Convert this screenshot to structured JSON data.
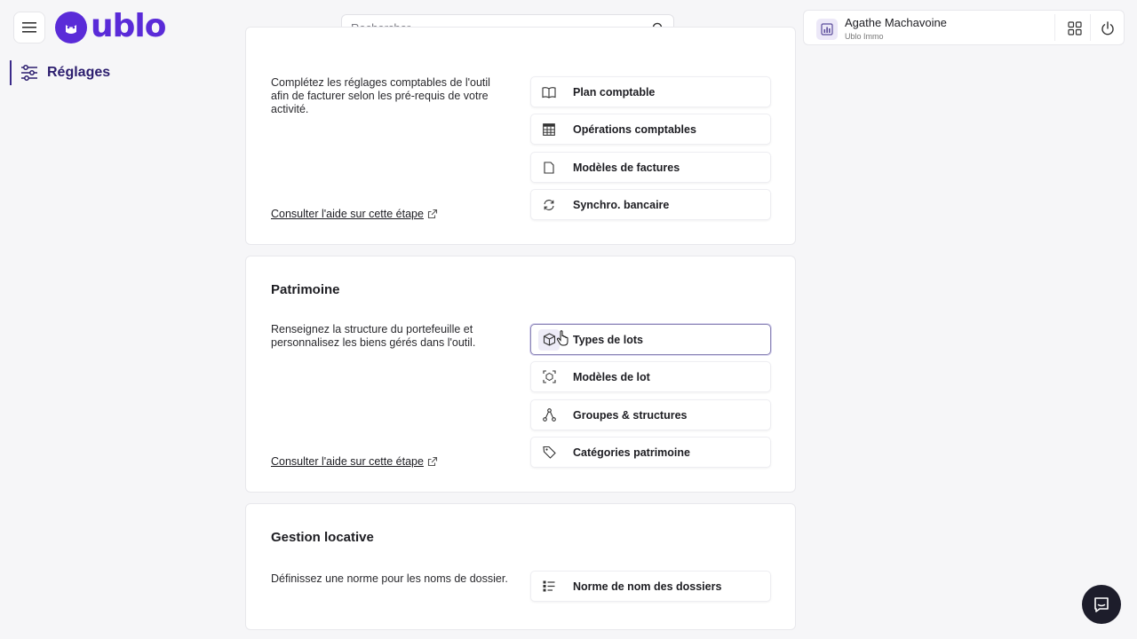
{
  "app": {
    "logo_text": "ublo"
  },
  "search": {
    "placeholder": "Rechercher"
  },
  "user": {
    "name": "Agathe Machavoine",
    "org": "Ublo Immo"
  },
  "sidebar": {
    "items": [
      {
        "label": "Réglages",
        "icon": "sliders-icon"
      }
    ]
  },
  "sections": [
    {
      "title": "",
      "description": "Complétez les réglages comptables de l'outil afin de facturer selon les pré-requis de votre activité.",
      "help": "Consulter l'aide sur cette étape",
      "options": [
        {
          "label": "Plan comptable",
          "icon": "book-icon"
        },
        {
          "label": "Opérations comptables",
          "icon": "table-icon"
        },
        {
          "label": "Modèles de factures",
          "icon": "document-icon"
        },
        {
          "label": "Synchro. bancaire",
          "icon": "sync-icon"
        }
      ]
    },
    {
      "title": "Patrimoine",
      "description": "Renseignez la structure du portefeuille et personnalisez les biens gérés dans l'outil.",
      "help": "Consulter l'aide sur cette étape",
      "options": [
        {
          "label": "Types de lots",
          "icon": "cube-icon",
          "active": true
        },
        {
          "label": "Modèles de lot",
          "icon": "scan-icon"
        },
        {
          "label": "Groupes & structures",
          "icon": "hierarchy-icon"
        },
        {
          "label": "Catégories patrimoine",
          "icon": "tag-icon"
        }
      ]
    },
    {
      "title": "Gestion locative",
      "description": "Définissez une norme pour les noms de dossier.",
      "options": [
        {
          "label": "Norme de nom des dossiers",
          "icon": "list-icon"
        }
      ]
    }
  ],
  "colors": {
    "brand": "#5a2bd8",
    "sidebar_active": "#2b1d6e",
    "chat": "#1d1d2b"
  }
}
